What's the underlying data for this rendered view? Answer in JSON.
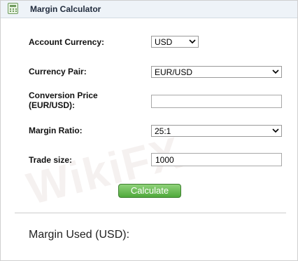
{
  "window": {
    "title": "Margin Calculator",
    "icon": "calculator-icon"
  },
  "form": {
    "account_currency": {
      "label": "Account Currency:",
      "value": "USD"
    },
    "currency_pair": {
      "label": "Currency Pair:",
      "value": "EUR/USD"
    },
    "conversion_price": {
      "label_line1": "Conversion Price",
      "label_line2": "(EUR/USD):",
      "value": ""
    },
    "margin_ratio": {
      "label": "Margin Ratio:",
      "value": "25:1"
    },
    "trade_size": {
      "label": "Trade size:",
      "value": "1000"
    },
    "calculate_label": "Calculate"
  },
  "result": {
    "label": "Margin Used (USD):"
  },
  "watermark": {
    "text": "WikiFX"
  },
  "colors": {
    "accent_green": "#4fa93b",
    "title_bg": "#eef3f8"
  }
}
